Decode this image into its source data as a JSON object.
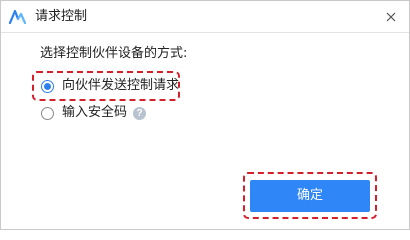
{
  "window": {
    "title": "请求控制",
    "app_icon": "anyviewer-logo-icon",
    "close_icon": "close-icon"
  },
  "prompt": "选择控制伙伴设备的方式:",
  "options": [
    {
      "label": "向伙伴发送控制请求",
      "selected": true
    },
    {
      "label": "输入安全码",
      "selected": false,
      "help_icon": "help-icon",
      "help_symbol": "?"
    }
  ],
  "ok_button": {
    "label": "确定"
  },
  "colors": {
    "accent": "#2f86f6",
    "highlight": "#d4202a"
  }
}
